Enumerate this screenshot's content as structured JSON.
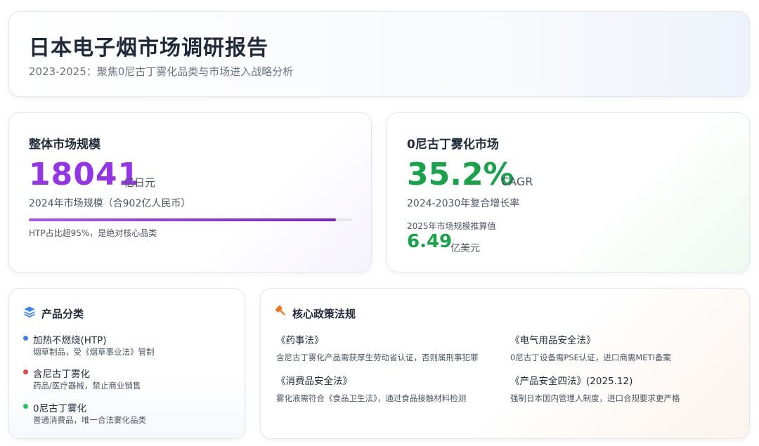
{
  "header": {
    "title": "日本电子烟市场调研报告",
    "subtitle": "2023-2025：聚焦0尼古丁雾化品类与市场进入战略分析"
  },
  "market_size": {
    "title": "整体市场规模",
    "value": "18041",
    "unit": "亿日元",
    "description": "2024年市场规模（合902亿人民币）",
    "progress_fraction": 0.95,
    "progress_note": "HTP占比超95%，是绝对核心品类",
    "accent_color": "#9333ea"
  },
  "zero_nicotine_market": {
    "title": "0尼古丁雾化市场",
    "value": "35.2%",
    "unit": "CAGR",
    "description": "2024-2030年复合增长率",
    "estimate_label": "2025年市场规模推算值",
    "estimate_value": "6.49",
    "estimate_unit": "亿美元",
    "accent_color": "#16a34a"
  },
  "product_categories": {
    "title": "产品分类",
    "icon": "layers-icon",
    "items": [
      {
        "name": "加热不燃烧(HTP)",
        "note": "烟草制品，受《烟草事业法》管制",
        "color": "#3b82f6"
      },
      {
        "name": "含尼古丁雾化",
        "note": "药品/医疗器械，禁止商业销售",
        "color": "#ef4444"
      },
      {
        "name": "0尼古丁雾化",
        "note": "普通消费品，唯一合法雾化品类",
        "color": "#22c55e"
      }
    ]
  },
  "policy": {
    "title": "核心政策法规",
    "icon": "gavel-icon",
    "laws": [
      {
        "name": "《药事法》",
        "note": "含尼古丁雾化产品需获厚生劳动省认证，否则属刑事犯罪"
      },
      {
        "name": "《电气用品安全法》",
        "note": "0尼古丁设备需PSE认证，进口商需METI备案"
      },
      {
        "name": "《消费品安全法》",
        "note": "雾化液需符合《食品卫生法》，通过食品接触材料检测"
      },
      {
        "name": "《产品安全四法》(2025.12)",
        "note": "强制日本国内管理人制度，进口合规要求更严格"
      }
    ]
  }
}
